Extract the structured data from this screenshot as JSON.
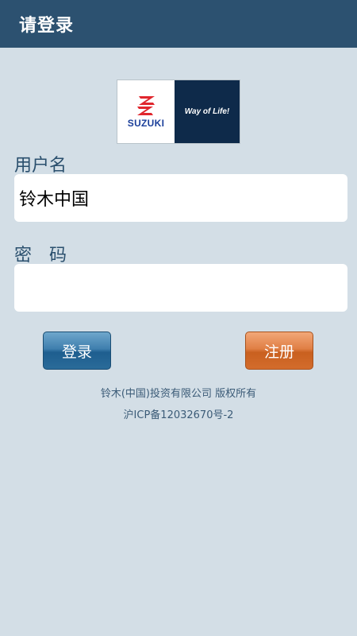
{
  "header": {
    "title": "请登录"
  },
  "logo": {
    "brand_text": "SUZUKI",
    "tagline": "Way of Life!",
    "colors": {
      "emblem": "#e0262d",
      "brand_text": "#1b3f9a",
      "panel_dark": "#0e2a4a"
    }
  },
  "form": {
    "username_label": "用户名",
    "username_value": "铃木中国",
    "password_label": "密　码",
    "password_value": ""
  },
  "buttons": {
    "login_label": "登录",
    "register_label": "注册"
  },
  "footer": {
    "copyright": "铃木(中国)投资有限公司 版权所有",
    "icp": "沪ICP备12032670号-2"
  },
  "colors": {
    "background": "#d3dee6",
    "header": "#2c5170",
    "login_button": "#2a6b99",
    "register_button": "#d36c2c"
  }
}
